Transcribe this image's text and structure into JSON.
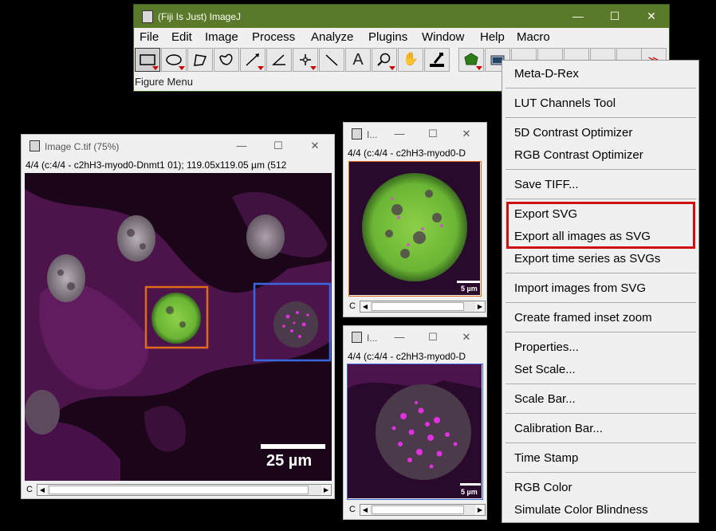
{
  "main_window": {
    "title": "(Fiji Is Just) ImageJ",
    "minimize": "—",
    "maximize": "☐",
    "close": "✕",
    "menus": [
      "File",
      "Edit",
      "Image",
      "Process",
      "Analyze",
      "Plugins",
      "Window",
      "Help",
      "Macro"
    ],
    "status": "Figure Menu",
    "more_tools": "≫",
    "tool_icons": [
      "rectangle-tool-icon",
      "oval-tool-icon",
      "polygon-tool-icon",
      "freehand-tool-icon",
      "straight-line-tool-icon",
      "angle-tool-icon",
      "point-tool-icon",
      "wand-tool-icon",
      "text-tool-icon",
      "magnifier-tool-icon",
      "hand-tool-icon",
      "color-picker-tool-icon",
      "figure-tool-icon",
      "image-tool-icon"
    ]
  },
  "image_c": {
    "title": "Image C.tif (75%)",
    "info": "4/4 (c:4/4 - c2hH3-myod0-Dnmt1 01); 119.05x119.05 µm (512",
    "channel": "C",
    "scalebar": "25 µm"
  },
  "inset_top": {
    "title": "I...",
    "info": "4/4 (c:4/4 - c2hH3-myod0-D",
    "channel": "C",
    "scalebar": "5 µm"
  },
  "inset_bottom": {
    "title": "I...",
    "info": "4/4 (c:4/4 - c2hH3-myod0-D",
    "channel": "C",
    "scalebar": "5 µm"
  },
  "figure_menu": {
    "items": [
      "Meta-D-Rex",
      "LUT Channels Tool",
      "5D Contrast Optimizer",
      "RGB Contrast Optimizer",
      "Save TIFF...",
      "Export SVG",
      "Export all images as SVG",
      "Export time series as SVGs",
      "Import images from SVG",
      "Create framed inset zoom",
      "Properties...",
      "Set Scale...",
      "Scale Bar...",
      "Calibration Bar...",
      "Time Stamp",
      "RGB Color",
      "Simulate Color Blindness"
    ],
    "highlighted": [
      "Export SVG",
      "Export all images as SVG"
    ]
  },
  "colors": {
    "title_green": "#5a7a2a",
    "highlight_red": "#d01010",
    "inset_orange": "#e06a1c",
    "inset_blue": "#3a66e0",
    "nucleus_green": "#7ac83a",
    "cytoplasm_magenta": "#7a1a7a"
  }
}
